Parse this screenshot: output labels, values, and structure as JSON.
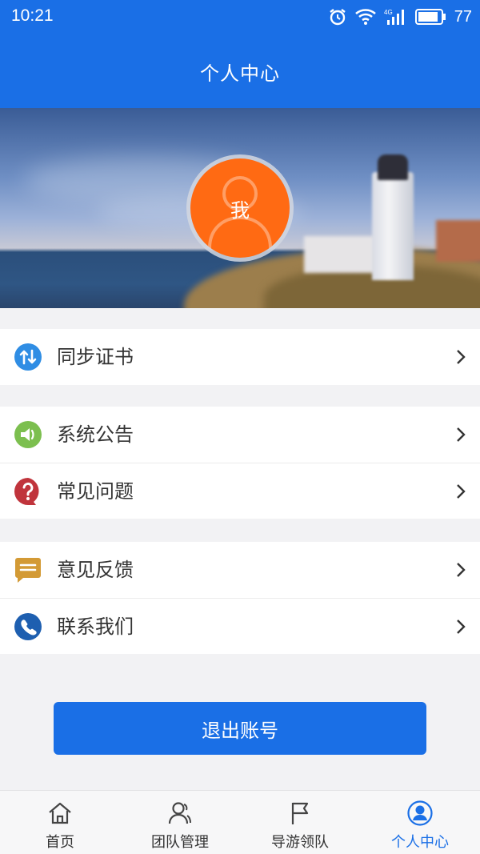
{
  "status_bar": {
    "time": "10:21",
    "battery": "77",
    "network": "4G"
  },
  "header": {
    "title": "个人中心"
  },
  "profile": {
    "avatar_label": "我"
  },
  "menu_groups": [
    [
      {
        "label": "同步证书",
        "icon": "sync-icon"
      }
    ],
    [
      {
        "label": "系统公告",
        "icon": "speaker-icon"
      },
      {
        "label": "常见问题",
        "icon": "question-icon"
      }
    ],
    [
      {
        "label": "意见反馈",
        "icon": "feedback-icon"
      },
      {
        "label": "联系我们",
        "icon": "phone-icon"
      }
    ]
  ],
  "logout_button": "退出账号",
  "tabs": [
    {
      "label": "首页",
      "icon": "home-icon"
    },
    {
      "label": "团队管理",
      "icon": "team-icon"
    },
    {
      "label": "导游领队",
      "icon": "flag-icon"
    },
    {
      "label": "个人中心",
      "icon": "user-icon",
      "active": true
    }
  ],
  "colors": {
    "primary": "#1a6fe6",
    "avatar": "#ff6a13",
    "sync": "#2f8de4",
    "speaker": "#7cbf4f",
    "question": "#c0343c",
    "feedback": "#d39a35",
    "phone": "#1e5fb0"
  }
}
